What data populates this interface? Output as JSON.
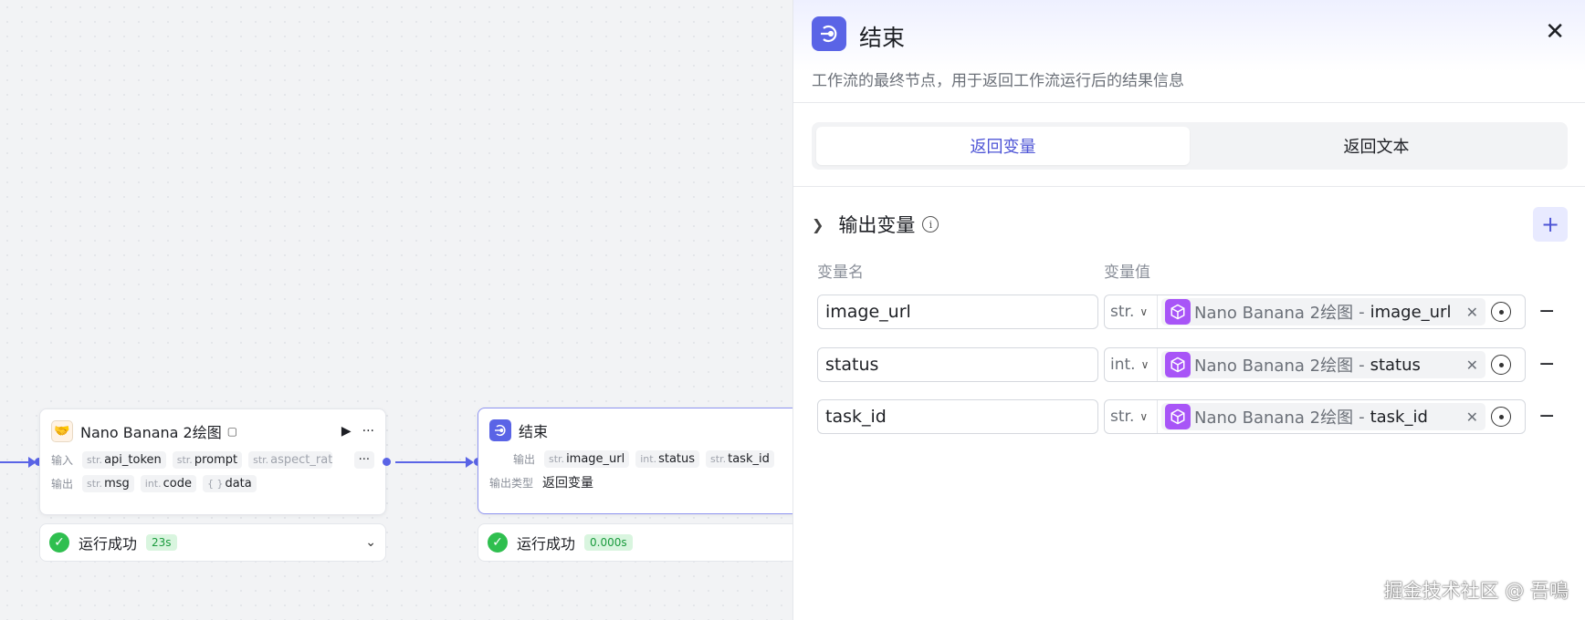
{
  "canvas": {
    "node1": {
      "title": "Nano Banana 2绘图",
      "input_label": "输入",
      "output_label": "输出",
      "inputs": [
        {
          "type": "str.",
          "name": "api_token"
        },
        {
          "type": "str.",
          "name": "prompt"
        },
        {
          "type": "str.",
          "name": "aspect_ratio"
        }
      ],
      "outputs": [
        {
          "type": "str.",
          "name": "msg"
        },
        {
          "type": "int.",
          "name": "code"
        },
        {
          "type": "{ }",
          "name": "data"
        }
      ],
      "more_inputs": "···",
      "status": "运行成功",
      "duration": "23s"
    },
    "node2": {
      "title": "结束",
      "output_label": "输出",
      "outputs": [
        {
          "type": "str.",
          "name": "image_url"
        },
        {
          "type": "int.",
          "name": "status"
        },
        {
          "type": "str.",
          "name": "task_id"
        }
      ],
      "output_type_label": "输出类型",
      "output_type_value": "返回变量",
      "status": "运行成功",
      "duration": "0.000s"
    }
  },
  "panel": {
    "title": "结束",
    "description": "工作流的最终节点，用于返回工作流运行后的结果信息",
    "close": "✕",
    "tabs": [
      {
        "label": "返回变量",
        "active": true
      },
      {
        "label": "返回文本",
        "active": false
      }
    ],
    "section_title": "输出变量",
    "add_label": "+",
    "col_name": "变量名",
    "col_value": "变量值",
    "rows": [
      {
        "name": "image_url",
        "type": "str.",
        "source": "Nano Banana 2绘图",
        "sep": "-",
        "var": "image_url"
      },
      {
        "name": "status",
        "type": "int.",
        "source": "Nano Banana 2绘图",
        "sep": "-",
        "var": "status"
      },
      {
        "name": "task_id",
        "type": "str.",
        "source": "Nano Banana 2绘图",
        "sep": "-",
        "var": "task_id"
      }
    ]
  },
  "watermark": "掘金技术社区 @ 吾鳴",
  "colors": {
    "accent": "#5a64e6",
    "success": "#2fbf4f",
    "cube": "#a855f7"
  }
}
